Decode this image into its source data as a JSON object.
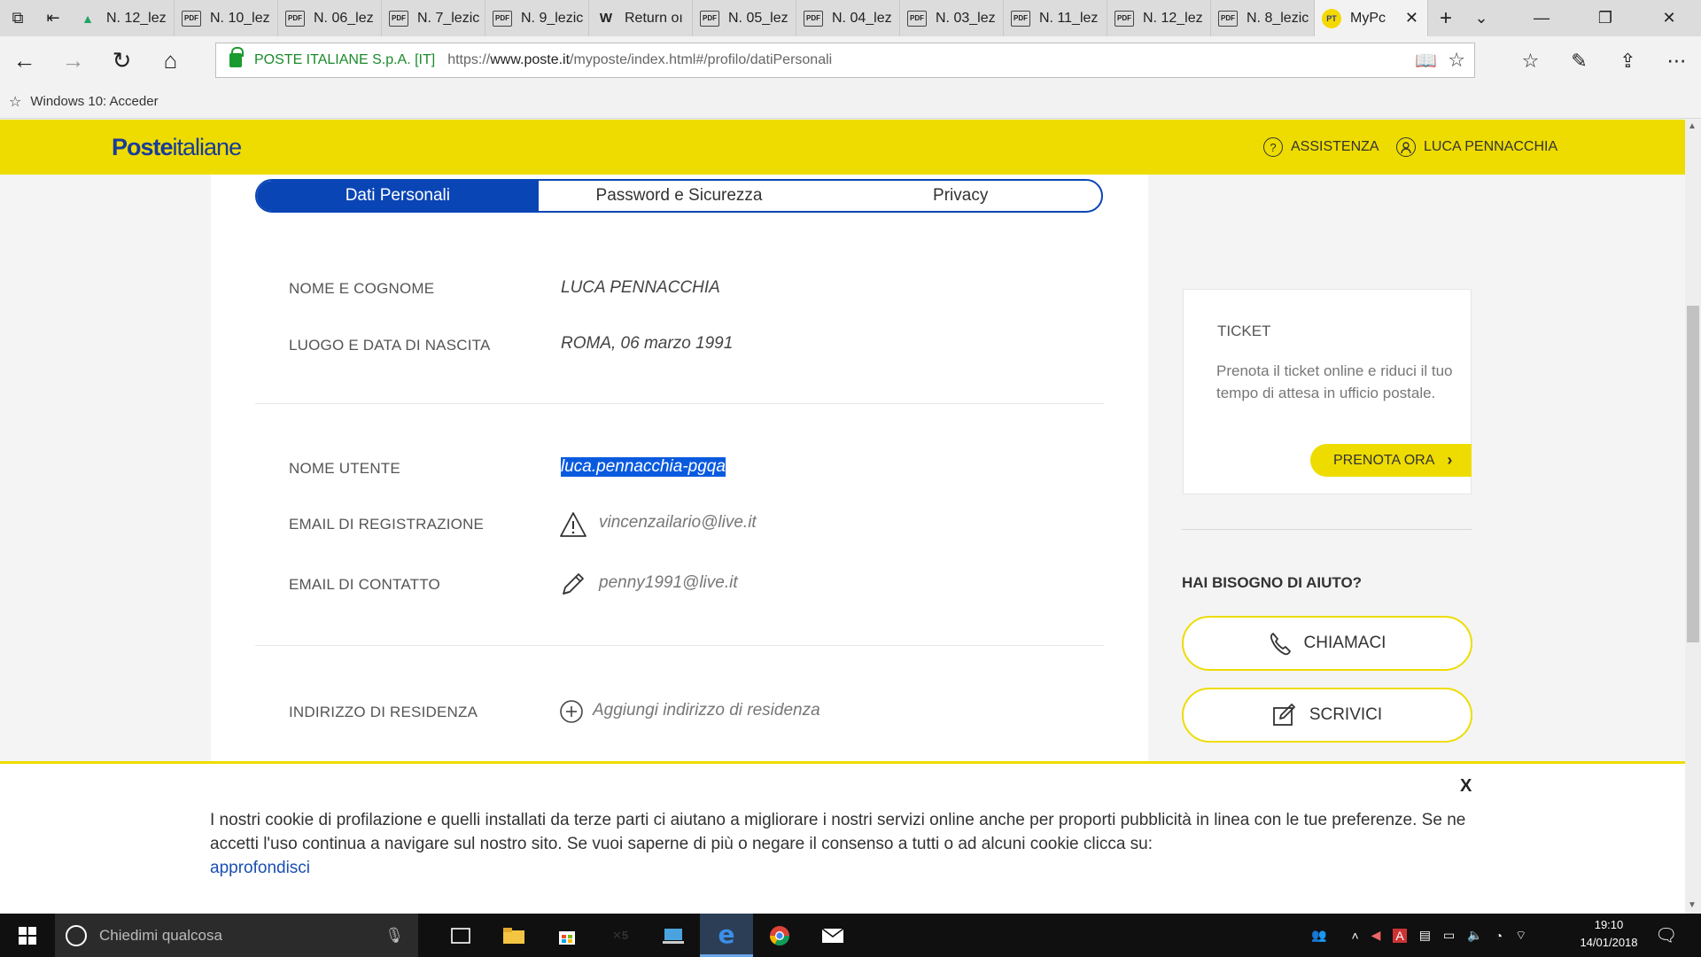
{
  "browser": {
    "tabs": [
      {
        "label": "N. 12_lez",
        "icon": "drive"
      },
      {
        "label": "N. 10_lez",
        "icon": "pdf"
      },
      {
        "label": "N. 06_lez",
        "icon": "pdf"
      },
      {
        "label": "N. 7_lezic",
        "icon": "pdf"
      },
      {
        "label": "N. 9_lezic",
        "icon": "pdf"
      },
      {
        "label": "Return oı",
        "icon": "W"
      },
      {
        "label": "N. 05_lez",
        "icon": "pdf"
      },
      {
        "label": "N. 04_lez",
        "icon": "pdf"
      },
      {
        "label": "N. 03_lez",
        "icon": "pdf"
      },
      {
        "label": "N. 11_lez",
        "icon": "pdf"
      },
      {
        "label": "N. 12_lez",
        "icon": "pdf"
      },
      {
        "label": "N. 8_lezic",
        "icon": "pdf"
      }
    ],
    "active_tab": {
      "label": "MyPc",
      "favicon_text": "PT"
    },
    "address": {
      "org": "POSTE ITALIANE S.p.A. [IT]",
      "url_prefix": "https://",
      "url_host": "www.poste.it",
      "url_path": "/myposte/index.html#/profilo/datiPersonali"
    },
    "favorites": [
      {
        "label": "Windows 10: Acceder"
      }
    ]
  },
  "header": {
    "logo_bold": "Poste",
    "logo_light": "italiane",
    "assistenza": "ASSISTENZA",
    "user": "LUCA PENNACCHIA"
  },
  "profile": {
    "tabs": [
      "Dati Personali",
      "Password e Sicurezza",
      "Privacy"
    ],
    "fields": {
      "nome_label": "NOME E COGNOME",
      "nome_value": "LUCA PENNACCHIA",
      "nascita_label": "LUOGO E DATA DI NASCITA",
      "nascita_value": "ROMA, 06 marzo 1991",
      "utente_label": "NOME UTENTE",
      "utente_value": "luca.pennacchia-pgqa",
      "email_reg_label": "EMAIL DI REGISTRAZIONE",
      "email_reg_value": "vincenzailario@live.it",
      "email_cont_label": "EMAIL DI CONTATTO",
      "email_cont_value": "penny1991@live.it",
      "indirizzo_label": "INDIRIZZO DI RESIDENZA",
      "indirizzo_value": "Aggiungi indirizzo di residenza"
    }
  },
  "sidebar": {
    "ticket_title": "TICKET",
    "ticket_desc": "Prenota il ticket online e riduci il tuo tempo di attesa in ufficio postale.",
    "ticket_button": "PRENOTA ORA",
    "help_title": "HAI BISOGNO DI AIUTO?",
    "call_button": "CHIAMACI",
    "write_button": "SCRIVICI"
  },
  "cookie": {
    "close": "X",
    "text": "I nostri cookie di profilazione e quelli installati da terze parti ci aiutano a migliorare i nostri servizi online anche per proporti pubblicità in linea con le tue preferenze. Se ne accetti l'uso continua a navigare sul nostro sito. Se vuoi saperne di più o negare il consenso a tutti o ad alcuni cookie clicca su:",
    "link": "approfondisci"
  },
  "taskbar": {
    "search_placeholder": "Chiedimi qualcosa",
    "time": "19:10",
    "date": "14/01/2018"
  },
  "colors": {
    "brand_yellow": "#eedc00",
    "brand_blue": "#0a45b5"
  }
}
